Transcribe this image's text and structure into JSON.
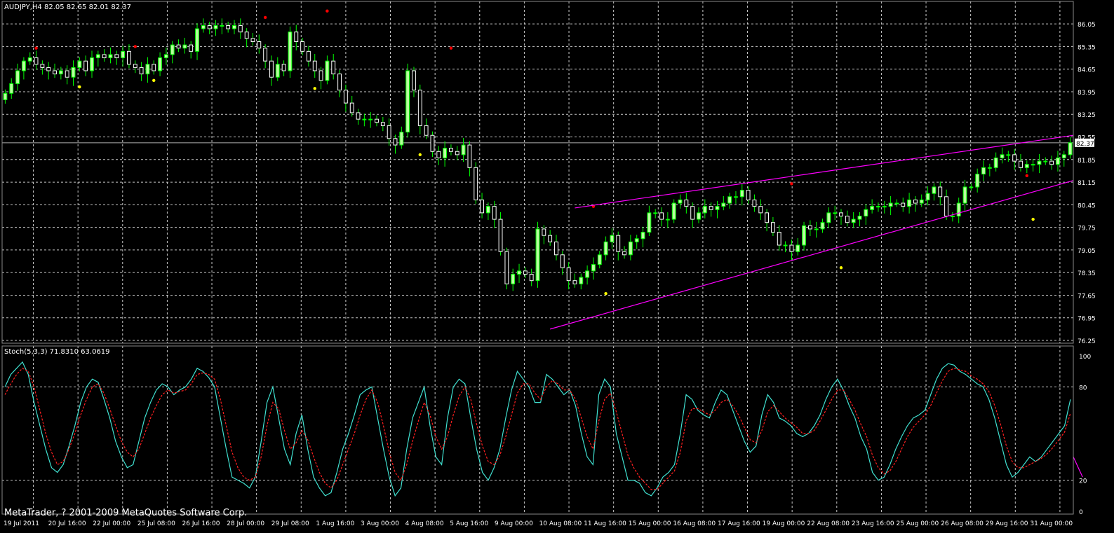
{
  "header": {
    "symbol_info": "AUDJPY,H4  82.05 82.65 82.01 82.37",
    "indicator_info": "Stoch(5,3,3) 71.8310 63.0619",
    "copyright": "MetaTrader, ? 2001-2009 MetaQuotes Software Corp."
  },
  "colors": {
    "background": "#000000",
    "grid": "#c8c8c8",
    "bull": "#b8ff9e",
    "bear": "#ffffff",
    "wick": "#00ff00",
    "fractal_up": "#ff0000",
    "fractal_down": "#ffff00",
    "trendline": "#ff00ff",
    "stoch_main": "#40e0d0",
    "stoch_signal": "#ff2020",
    "current_price_line": "#b0b0b0"
  },
  "chart_data": [
    {
      "type": "candlestick",
      "title": "AUDJPY,H4",
      "ylim": [
        76.25,
        86.4
      ],
      "y_ticks": [
        "86.05",
        "85.35",
        "84.65",
        "83.95",
        "83.25",
        "82.55",
        "81.85",
        "81.15",
        "80.45",
        "79.75",
        "79.05",
        "78.35",
        "77.65",
        "76.95",
        "76.25"
      ],
      "current_price_label": "82.37",
      "current_price": 82.37,
      "x_tick_labels": [
        "19 Jul 2011",
        "20 Jul 16:00",
        "22 Jul 00:00",
        "25 Jul 08:00",
        "26 Jul 16:00",
        "28 Jul 00:00",
        "29 Jul 08:00",
        "1 Aug 16:00",
        "3 Aug 00:00",
        "4 Aug 08:00",
        "5 Aug 16:00",
        "9 Aug 00:00",
        "10 Aug 08:00",
        "11 Aug 16:00",
        "15 Aug 00:00",
        "16 Aug 08:00",
        "17 Aug 16:00",
        "19 Aug 00:00",
        "22 Aug 08:00",
        "23 Aug 16:00",
        "25 Aug 00:00",
        "26 Aug 08:00",
        "29 Aug 16:00",
        "31 Aug 00:00"
      ],
      "close": [
        83.9,
        84.2,
        84.6,
        84.9,
        85.0,
        84.8,
        84.7,
        84.6,
        84.5,
        84.6,
        84.4,
        84.7,
        84.9,
        84.6,
        85.0,
        85.1,
        85.0,
        85.1,
        85.0,
        85.2,
        84.8,
        84.7,
        84.5,
        84.8,
        84.6,
        85.0,
        85.1,
        85.4,
        85.3,
        85.4,
        85.2,
        85.9,
        86.0,
        85.9,
        86.0,
        86.0,
        85.9,
        86.0,
        85.8,
        85.6,
        85.5,
        85.3,
        84.9,
        84.4,
        84.8,
        84.6,
        85.8,
        85.5,
        85.2,
        84.9,
        84.6,
        84.3,
        84.9,
        84.5,
        84.0,
        83.6,
        83.3,
        83.1,
        83.1,
        83.1,
        83.0,
        82.9,
        82.5,
        82.3,
        82.7,
        84.6,
        84.0,
        82.9,
        82.6,
        82.1,
        81.9,
        82.2,
        82.1,
        82.0,
        82.3,
        81.6,
        80.6,
        80.2,
        80.4,
        80.0,
        79.0,
        78.0,
        78.3,
        78.4,
        78.3,
        78.1,
        79.7,
        79.5,
        79.3,
        78.9,
        78.5,
        78.1,
        78.0,
        78.2,
        78.4,
        78.6,
        78.9,
        79.3,
        79.5,
        79.0,
        78.9,
        79.3,
        79.4,
        79.6,
        80.2,
        80.2,
        80.0,
        80.0,
        80.5,
        80.6,
        80.4,
        80.0,
        80.2,
        80.4,
        80.3,
        80.4,
        80.5,
        80.7,
        80.7,
        80.9,
        80.6,
        80.4,
        80.2,
        79.9,
        79.6,
        79.2,
        79.2,
        79.0,
        79.2,
        79.8,
        79.7,
        79.7,
        79.9,
        80.2,
        80.2,
        80.1,
        79.9,
        80.0,
        80.1,
        80.3,
        80.4,
        80.4,
        80.4,
        80.5,
        80.5,
        80.4,
        80.6,
        80.5,
        80.6,
        80.8,
        81.0,
        80.7,
        80.1,
        80.1,
        80.5,
        81.0,
        81.0,
        81.4,
        81.6,
        81.6,
        81.9,
        82.0,
        82.0,
        81.8,
        81.6,
        81.7,
        81.7,
        81.8,
        81.8,
        81.7,
        81.9,
        82.0,
        82.37
      ],
      "up_fractals": [
        [
          5,
          85.3
        ],
        [
          21,
          85.35
        ],
        [
          42,
          86.25
        ],
        [
          52,
          86.45
        ],
        [
          72,
          85.3
        ],
        [
          95,
          80.4
        ],
        [
          127,
          81.1
        ],
        [
          165,
          81.35
        ],
        [
          188,
          82.45
        ]
      ],
      "down_fractals": [
        [
          12,
          84.1
        ],
        [
          24,
          84.3
        ],
        [
          50,
          84.05
        ],
        [
          67,
          82.0
        ],
        [
          97,
          77.7
        ],
        [
          135,
          78.5
        ],
        [
          166,
          80.0
        ]
      ],
      "trendlines": [
        {
          "x1": 92,
          "y1": 80.35,
          "x2": 190,
          "y2": 82.6
        },
        {
          "x1": 88,
          "y1": 76.6,
          "x2": 190,
          "y2": 81.2
        }
      ]
    },
    {
      "type": "line",
      "title": "Stoch(5,3,3)",
      "ylim": [
        0,
        100
      ],
      "y_ticks": [
        "100",
        "80",
        "20",
        "0"
      ],
      "series": [
        {
          "values": [
            80,
            88,
            92,
            96,
            88,
            70,
            55,
            40,
            28,
            25,
            30,
            42,
            55,
            70,
            80,
            85,
            83,
            72,
            60,
            45,
            35,
            28,
            30,
            45,
            60,
            70,
            78,
            82,
            80,
            75,
            78,
            80,
            85,
            92,
            90,
            86,
            80,
            60,
            40,
            22,
            20,
            18,
            15,
            22,
            45,
            70,
            80,
            60,
            40,
            30,
            50,
            62,
            40,
            22,
            15,
            10,
            12,
            25,
            40,
            50,
            62,
            75,
            78,
            80,
            60,
            40,
            22,
            10,
            15,
            40,
            60,
            70,
            80,
            55,
            35,
            30,
            60,
            80,
            85,
            82,
            60,
            40,
            25,
            20,
            28,
            40,
            60,
            78,
            90,
            85,
            80,
            70,
            70,
            88,
            85,
            80,
            75,
            78,
            68,
            50,
            35,
            30,
            75,
            85,
            80,
            50,
            35,
            20,
            20,
            18,
            12,
            10,
            15,
            22,
            25,
            30,
            50,
            75,
            72,
            65,
            62,
            60,
            70,
            78,
            75,
            65,
            55,
            45,
            38,
            42,
            62,
            75,
            70,
            60,
            58,
            55,
            50,
            48,
            50,
            55,
            62,
            72,
            80,
            85,
            78,
            68,
            60,
            48,
            40,
            25,
            20,
            22,
            30,
            40,
            48,
            55,
            60,
            62,
            65,
            75,
            85,
            92,
            95,
            94,
            90,
            88,
            85,
            82,
            80,
            72,
            60,
            45,
            30,
            22,
            25,
            30,
            35,
            32,
            35,
            40,
            45,
            50,
            55,
            72
          ]
        },
        {
          "values": [
            75,
            82,
            88,
            92,
            90,
            80,
            65,
            50,
            38,
            30,
            32,
            40,
            50,
            62,
            72,
            80,
            82,
            76,
            66,
            55,
            45,
            38,
            35,
            40,
            50,
            60,
            68,
            75,
            78,
            76,
            77,
            78,
            82,
            88,
            89,
            88,
            85,
            72,
            55,
            38,
            28,
            22,
            20,
            22,
            35,
            55,
            70,
            66,
            52,
            40,
            44,
            52,
            46,
            35,
            25,
            18,
            15,
            20,
            30,
            40,
            50,
            62,
            72,
            78,
            70,
            55,
            38,
            25,
            20,
            30,
            45,
            58,
            70,
            62,
            48,
            40,
            48,
            62,
            74,
            80,
            72,
            56,
            42,
            32,
            30,
            36,
            48,
            62,
            76,
            82,
            82,
            76,
            72,
            80,
            84,
            82,
            78,
            78,
            72,
            60,
            48,
            40,
            58,
            72,
            76,
            64,
            50,
            36,
            28,
            22,
            18,
            14,
            14,
            18,
            22,
            26,
            38,
            58,
            66,
            66,
            64,
            62,
            65,
            70,
            72,
            68,
            62,
            54,
            46,
            44,
            52,
            64,
            68,
            64,
            60,
            57,
            54,
            50,
            50,
            52,
            58,
            65,
            72,
            78,
            78,
            72,
            65,
            56,
            48,
            36,
            28,
            24,
            26,
            32,
            40,
            48,
            54,
            58,
            62,
            68,
            76,
            84,
            90,
            92,
            91,
            90,
            87,
            85,
            82,
            77,
            68,
            56,
            42,
            32,
            28,
            28,
            30,
            32,
            34,
            37,
            41,
            46,
            51,
            63
          ]
        }
      ],
      "trendline": {
        "x1": 174,
        "y1": 22,
        "x2": 190,
        "y2": 35
      }
    }
  ]
}
